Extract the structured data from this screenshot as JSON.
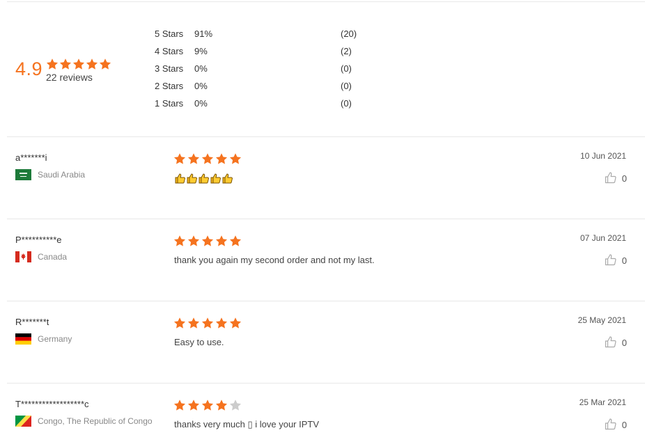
{
  "summary": {
    "average": "4.9",
    "average_rating": 4.9,
    "reviews_label": "22 reviews",
    "distribution": [
      {
        "label": "5  Stars",
        "pct": "91%",
        "count": "(20)"
      },
      {
        "label": "4  Stars",
        "pct": "9%",
        "count": "(2)"
      },
      {
        "label": "3  Stars",
        "pct": "0%",
        "count": "(0)"
      },
      {
        "label": "2  Stars",
        "pct": "0%",
        "count": "(0)"
      },
      {
        "label": "1  Stars",
        "pct": "0%",
        "count": "(0)"
      }
    ]
  },
  "colors": {
    "accent": "#f5731f",
    "star_empty": "#cccccc",
    "rule": "#e8e8e8"
  },
  "reviews": [
    {
      "reviewer": "a*******i",
      "country": "Saudi Arabia",
      "flag": "saudi-arabia-flag",
      "rating": 5,
      "text": "👍👍👍👍👍",
      "date": "10 Jun 2021",
      "likes": "0"
    },
    {
      "reviewer": "P**********e",
      "country": "Canada",
      "flag": "canada-flag",
      "rating": 5,
      "text": "thank you again my second order and not my last.",
      "date": "07 Jun 2021",
      "likes": "0"
    },
    {
      "reviewer": "R*******t",
      "country": "Germany",
      "flag": "germany-flag",
      "rating": 5,
      "text": "Easy to use.",
      "date": "25 May 2021",
      "likes": "0"
    },
    {
      "reviewer": "T******************c",
      "country": "Congo, The Republic of Congo",
      "flag": "congo-flag",
      "rating": 4,
      "text": "thanks very much ▯ i love your IPTV",
      "date": "25 Mar 2021",
      "likes": "0"
    }
  ]
}
